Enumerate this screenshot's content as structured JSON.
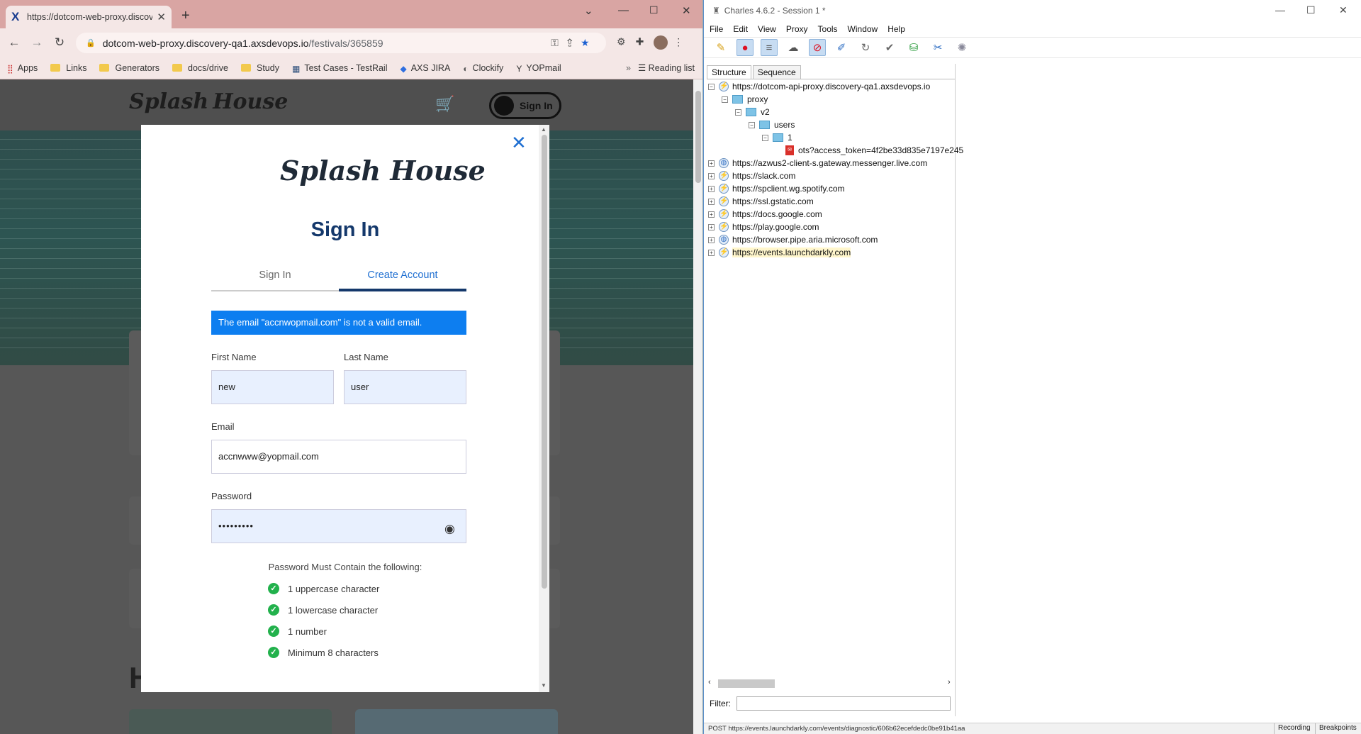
{
  "browser": {
    "tab_title": "https://dotcom-web-proxy.discov",
    "url_host": "dotcom-web-proxy.discovery-qa1.axsdevops.io",
    "url_path": "/festivals/365859",
    "bookmarks": [
      "Apps",
      "Links",
      "Generators",
      "docs/drive",
      "Study",
      "Test Cases - TestRail",
      "AXS JIRA",
      "Clockify",
      "YOPmail"
    ],
    "bookmarks_more": "»",
    "reading_list": "Reading list"
  },
  "site": {
    "header_sign_in": "Sign In",
    "logo_line1": "Splash",
    "logo_line2": "House",
    "behind_heading": "H"
  },
  "modal": {
    "close_glyph": "✕",
    "logo": "Splash House",
    "title": "Sign In",
    "tab_sign_in": "Sign In",
    "tab_create": "Create Account",
    "error": "The email \"accnwopmail.com\" is not a valid email.",
    "first_name_label": "First Name",
    "first_name_value": "new",
    "last_name_label": "Last Name",
    "last_name_value": "user",
    "email_label": "Email",
    "email_value": "accnwww@yopmail.com",
    "password_label": "Password",
    "password_value": "•••••••••",
    "password_rules_title": "Password Must Contain the following:",
    "rules": [
      "1 uppercase character",
      "1 lowercase character",
      "1 number",
      "Minimum 8 characters"
    ]
  },
  "charles": {
    "title": "Charles 4.6.2 - Session 1 *",
    "menu": [
      "File",
      "Edit",
      "View",
      "Proxy",
      "Tools",
      "Window",
      "Help"
    ],
    "tabs": [
      "Structure",
      "Sequence"
    ],
    "tree": {
      "root": "https://dotcom-api-proxy.discovery-qa1.axsdevops.io",
      "proxy": "proxy",
      "v2": "v2",
      "users": "users",
      "one": "1",
      "request": "ots?access_token=4f2be33d835e7197e245",
      "hosts": [
        "https://azwus2-client-s.gateway.messenger.live.com",
        "https://slack.com",
        "https://spclient.wg.spotify.com",
        "https://ssl.gstatic.com",
        "https://docs.google.com",
        "https://play.google.com",
        "https://browser.pipe.aria.microsoft.com",
        "https://events.launchdarkly.com"
      ]
    },
    "filter_label": "Filter:",
    "status": "POST https://events.launchdarkly.com/events/diagnostic/606b62ecefdedc0be91b41aa",
    "recording": "Recording",
    "breakpoints": "Breakpoints"
  },
  "colors": {
    "brand_navy": "#14386b",
    "link_blue": "#1f6fd1",
    "alert_blue": "#0d7ef0",
    "check_green": "#22b14c"
  }
}
